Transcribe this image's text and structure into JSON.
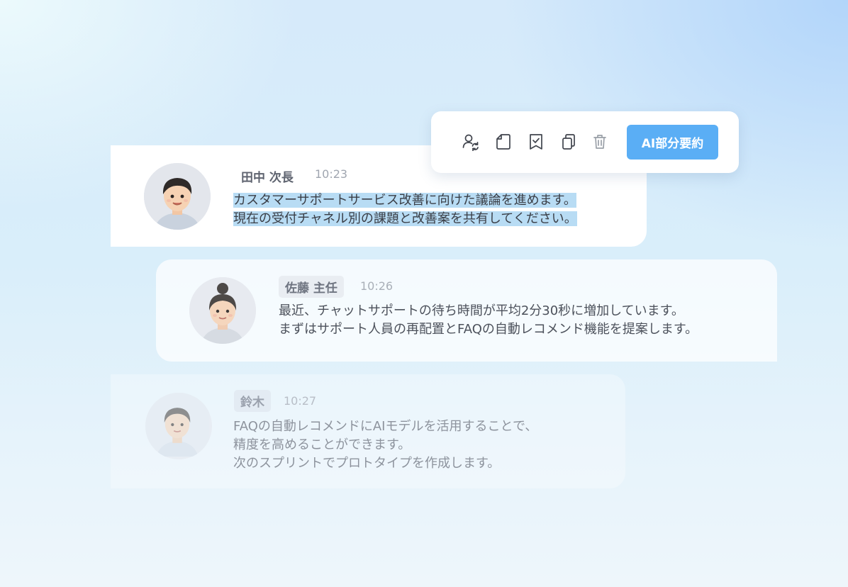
{
  "toolbar": {
    "icons": [
      "user-switch-icon",
      "document-icon",
      "bookmark-check-icon",
      "copy-icon",
      "trash-icon"
    ],
    "ai_button_label": "AI部分要約",
    "ai_button_color": "#5aaef5"
  },
  "messages": [
    {
      "name": "田中 次長",
      "time": "10:23",
      "lines": [
        "カスタマーサポートサービス改善に向けた議論を進めます。",
        "現在の受付チャネル別の課題と改善案を共有してください。"
      ],
      "selected": true
    },
    {
      "name": "佐藤 主任",
      "time": "10:26",
      "lines": [
        "最近、チャットサポートの待ち時間が平均2分30秒に増加しています。",
        "まずはサポート人員の再配置とFAQの自動レコメンド機能を提案します。"
      ]
    },
    {
      "name": "鈴木",
      "time": "10:27",
      "lines": [
        "FAQの自動レコメンドにAIモデルを活用することで、",
        "精度を高めることができます。",
        "次のスプリントでプロトタイプを作成します。"
      ]
    }
  ],
  "colors": {
    "selection_highlight": "#b8dcf4",
    "accent": "#5aaef5"
  }
}
